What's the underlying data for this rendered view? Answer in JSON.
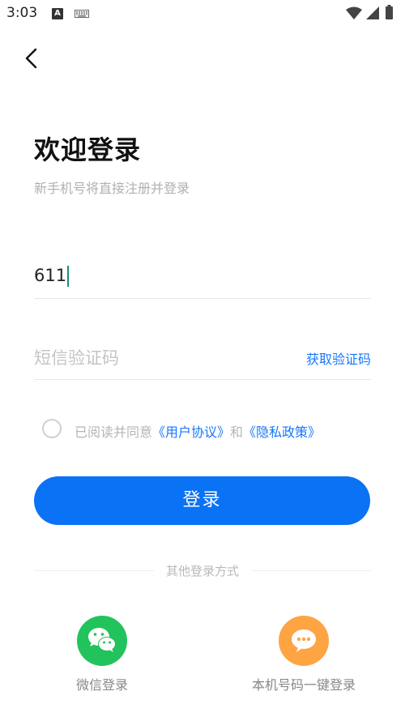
{
  "status_bar": {
    "time": "3:03",
    "a_indicator": "A"
  },
  "header": {
    "title": "欢迎登录",
    "subtitle": "新手机号将直接注册并登录"
  },
  "form": {
    "phone_value": "611",
    "code_placeholder": "短信验证码",
    "get_code_label": "获取验证码"
  },
  "agreement": {
    "prefix": "已阅读并同意",
    "user_agreement": "《用户协议》",
    "and": "和",
    "privacy_policy": "《隐私政策》",
    "checked": false
  },
  "login_button": "登录",
  "other_login": {
    "divider_label": "其他登录方式",
    "options": [
      {
        "label": "微信登录",
        "icon": "wechat-icon",
        "color": "#22c35c"
      },
      {
        "label": "本机号码一键登录",
        "icon": "chat-bubble-icon",
        "color": "#fea443"
      }
    ]
  },
  "colors": {
    "accent": "#0a72f5",
    "link": "#1677ff"
  }
}
